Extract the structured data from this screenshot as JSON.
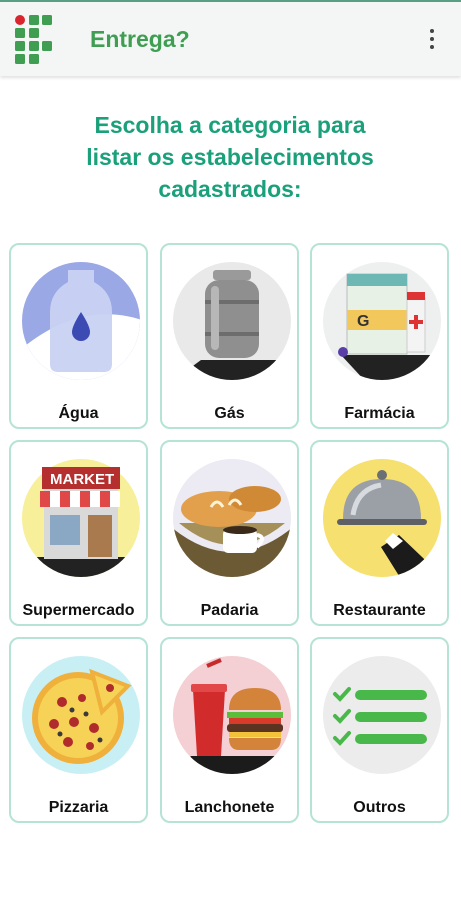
{
  "app": {
    "title": "Entrega?"
  },
  "heading": {
    "line1": "Escolha a categoria para",
    "line2": "listar os estabelecimentos",
    "line3": "cadastrados:"
  },
  "categories": [
    {
      "label": "Água",
      "icon": "water-jug-icon"
    },
    {
      "label": "Gás",
      "icon": "gas-cylinder-icon"
    },
    {
      "label": "Farmácia",
      "icon": "pharmacy-icon"
    },
    {
      "label": "Supermercado",
      "icon": "market-icon"
    },
    {
      "label": "Padaria",
      "icon": "bread-coffee-icon"
    },
    {
      "label": "Restaurante",
      "icon": "cloche-icon"
    },
    {
      "label": "Pizzaria",
      "icon": "pizza-icon"
    },
    {
      "label": "Lanchonete",
      "icon": "burger-icon"
    },
    {
      "label": "Outros",
      "icon": "checklist-icon"
    }
  ],
  "colors": {
    "accent": "#1aa07a",
    "title": "#3f9e52",
    "card_border": "#b5e3d6"
  }
}
